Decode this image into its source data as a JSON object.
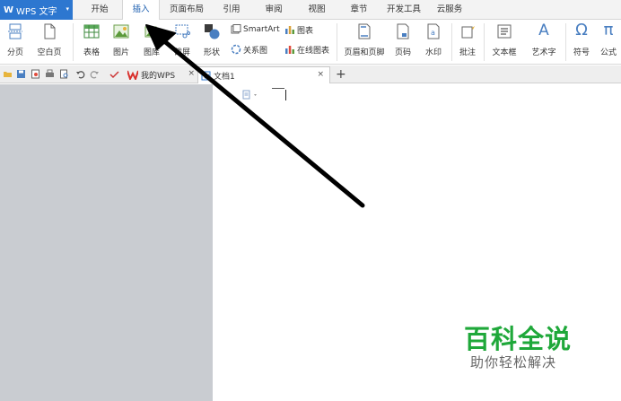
{
  "app": {
    "name": "WPS 文字",
    "logo": "W",
    "caret": "▾"
  },
  "menu_tabs": [
    "开始",
    "插入",
    "页面布局",
    "引用",
    "审阅",
    "视图",
    "章节",
    "开发工具",
    "云服务"
  ],
  "active_tab": "插入",
  "ribbon": {
    "page_break": "分页",
    "blank_page": "空白页",
    "table": "表格",
    "picture": "图片",
    "gallery": "图库",
    "screenshot": "截屏",
    "shapes": "形状",
    "smartart": "SmartArt",
    "chart": "图表",
    "relation": "关系图",
    "online_chart": "在线图表",
    "header_footer": "页眉和页脚",
    "page_number": "页码",
    "watermark": "水印",
    "comment": "批注",
    "textbox": "文本框",
    "wordart": "艺术字",
    "symbol": "符号",
    "formula": "公式",
    "symbol_glyph": "Ω",
    "formula_glyph": "π",
    "wordart_glyph": "A"
  },
  "tabs": {
    "my_wps": "我的WPS",
    "doc1": "文档1",
    "close": "×",
    "new_tab": "+"
  },
  "watermark": {
    "main": "百科全说",
    "sub": "助你轻松解决"
  },
  "colors": {
    "brand_blue": "#2d77d0",
    "wps_red": "#d9302c",
    "watermark_green": "#1fa83a",
    "workspace_gray": "#c9ccd1"
  },
  "icons": [
    "save-icon",
    "open-folder-icon",
    "print-icon",
    "undo-icon",
    "redo-icon",
    "table-icon",
    "picture-icon",
    "shape-icon",
    "chart-icon",
    "header-footer-icon",
    "comment-icon",
    "textbox-icon"
  ]
}
